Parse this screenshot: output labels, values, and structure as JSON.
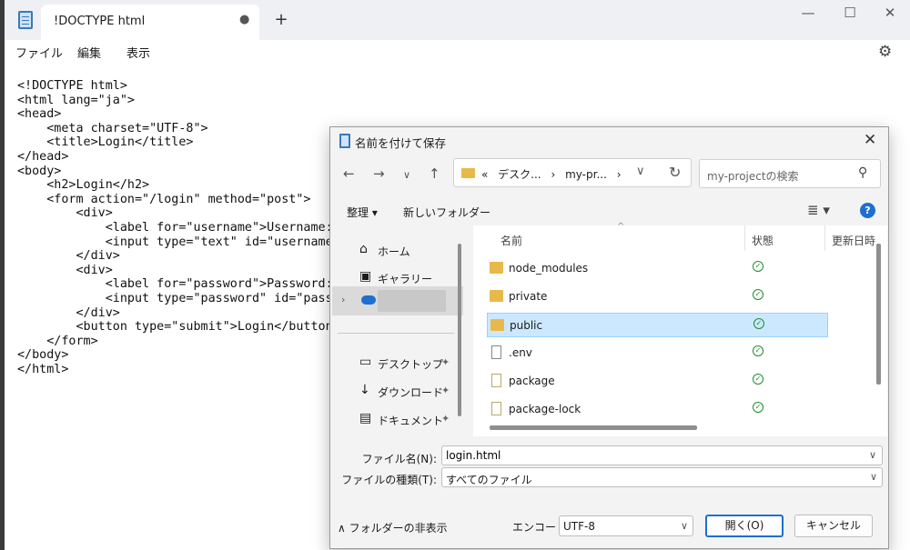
{
  "notepad": {
    "tab_title": "!DOCTYPE html",
    "tab_modified": "●",
    "new_tab": "+",
    "menu": {
      "file": "ファイル",
      "edit": "編集",
      "view": "表示"
    },
    "code_lines": [
      "<!DOCTYPE html>",
      "<html lang=\"ja\">",
      "<head>",
      "    <meta charset=\"UTF-8\">",
      "    <title>Login</title>",
      "</head>",
      "<body>",
      "    <h2>Login</h2>",
      "    <form action=\"/login\" method=\"post\">",
      "        <div>",
      "            <label for=\"username\">Username:<",
      "            <input type=\"text\" id=\"username\"",
      "        </div>",
      "        <div>",
      "            <label for=\"password\">Password:<",
      "            <input type=\"password\" id=\"passw",
      "        </div>",
      "        <button type=\"submit\">Login</button>",
      "    </form>",
      "</body>",
      "</html>"
    ]
  },
  "dialog": {
    "title": "名前を付けて保存",
    "address": {
      "prefix": "«",
      "segments": [
        "デスク...",
        "my-pr..."
      ],
      "separator": "›"
    },
    "search_placeholder": "my-projectの検索",
    "toolbar": {
      "organize": "整理 ▾",
      "new_folder": "新しいフォルダー",
      "help": "?"
    },
    "nav": {
      "home": "ホーム",
      "gallery": "ギャラリー",
      "desktop": "デスクトップ",
      "downloads": "ダウンロード",
      "documents": "ドキュメント"
    },
    "columns": {
      "name": "名前",
      "state": "状態",
      "date": "更新日時"
    },
    "files": [
      {
        "name": "node_modules",
        "kind": "folder"
      },
      {
        "name": "private",
        "kind": "folder"
      },
      {
        "name": "public",
        "kind": "folder",
        "selected": true
      },
      {
        "name": ".env",
        "kind": "file"
      },
      {
        "name": "package",
        "kind": "json"
      },
      {
        "name": "package-lock",
        "kind": "json"
      }
    ],
    "filename_label": "ファイル名(N):",
    "filename_value": "login.html",
    "filetype_label": "ファイルの種類(T):",
    "filetype_value": "すべてのファイル",
    "hide_folders": "フォルダーの非表示",
    "encoding_label": "エンコード:",
    "encoding_value": "UTF-8",
    "open_button": "開く(O)",
    "cancel_button": "キャンセル"
  }
}
